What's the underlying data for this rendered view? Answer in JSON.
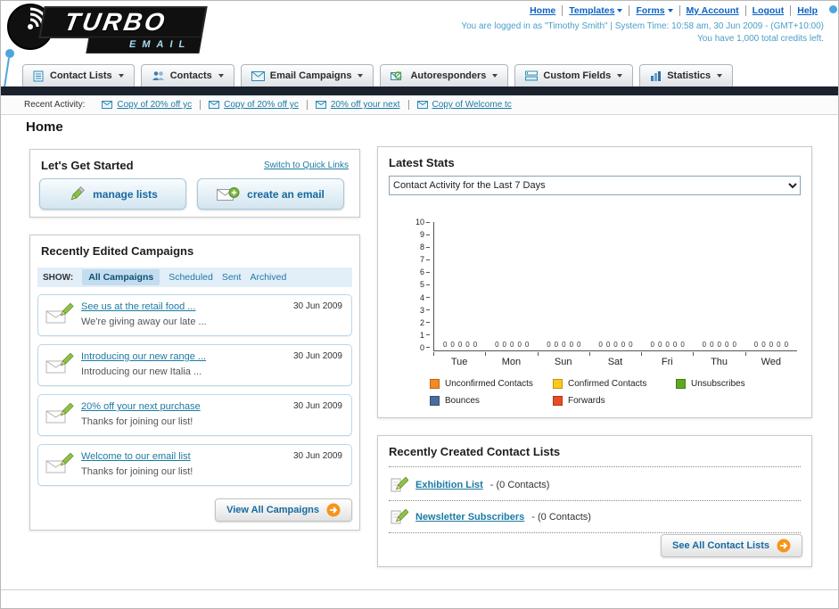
{
  "colors": {
    "accent_teal": "#1b7aa3",
    "navy_bar": "#1b222d",
    "orange": "#f7941d"
  },
  "header": {
    "logo_line1": "TURBO",
    "logo_line2": "EMAIL",
    "nav_links": [
      {
        "label": "Home",
        "dropdown": false
      },
      {
        "label": "Templates",
        "dropdown": true
      },
      {
        "label": "Forms",
        "dropdown": true
      },
      {
        "label": "My Account",
        "dropdown": false
      },
      {
        "label": "Logout",
        "dropdown": false
      },
      {
        "label": "Help",
        "dropdown": false
      }
    ],
    "login_info": "You are logged in as \"Timothy Smith\" | System Time: 10:58 am, 30 Jun 2009 - (GMT+10:00)",
    "credits_info": "You have 1,000 total credits left."
  },
  "main_nav": {
    "items": [
      {
        "label": "Contact Lists"
      },
      {
        "label": "Contacts"
      },
      {
        "label": "Email Campaigns"
      },
      {
        "label": "Autoresponders"
      },
      {
        "label": "Custom Fields"
      },
      {
        "label": "Statistics"
      }
    ]
  },
  "recent_activity": {
    "label": "Recent Activity:",
    "items": [
      {
        "label": "Copy of 20% off yc"
      },
      {
        "label": "Copy of 20% off yc"
      },
      {
        "label": "20% off your next"
      },
      {
        "label": "Copy of Welcome tc"
      }
    ]
  },
  "page": {
    "title": "Home"
  },
  "get_started": {
    "title": "Let's Get Started",
    "switch_link": "Switch to Quick Links",
    "manage_lists_label": "manage lists",
    "create_email_label": "create an email"
  },
  "campaigns": {
    "title": "Recently Edited Campaigns",
    "show_label": "SHOW:",
    "tabs": [
      {
        "label": "All Campaigns",
        "active": true
      },
      {
        "label": "Scheduled",
        "active": false
      },
      {
        "label": "Sent",
        "active": false
      },
      {
        "label": "Archived",
        "active": false
      }
    ],
    "items": [
      {
        "title": "See us at the retail food ...",
        "subtitle": "We're giving away our late ...",
        "date": "30 Jun 2009"
      },
      {
        "title": "Introducing our new range ...",
        "subtitle": "Introducing our new Italia ...",
        "date": "30 Jun 2009"
      },
      {
        "title": "20% off your next purchase",
        "subtitle": "Thanks for joining our list!",
        "date": "30 Jun 2009"
      },
      {
        "title": "Welcome to our email list",
        "subtitle": "Thanks for joining our list!",
        "date": "30 Jun 2009"
      }
    ],
    "view_all_label": "View All Campaigns"
  },
  "latest_stats": {
    "title": "Latest Stats",
    "selected_option": "Contact Activity for the Last 7 Days",
    "chart_data": {
      "type": "bar",
      "title": "Contact Activity for the Last 7 Days",
      "categories": [
        "Tue",
        "Mon",
        "Sun",
        "Sat",
        "Fri",
        "Thu",
        "Wed"
      ],
      "series": [
        {
          "name": "Unconfirmed Contacts",
          "color": "#f6891f",
          "values": [
            0,
            0,
            0,
            0,
            0,
            0,
            0
          ]
        },
        {
          "name": "Confirmed Contacts",
          "color": "#fdc918",
          "values": [
            0,
            0,
            0,
            0,
            0,
            0,
            0
          ]
        },
        {
          "name": "Unsubscribes",
          "color": "#5da81f",
          "values": [
            0,
            0,
            0,
            0,
            0,
            0,
            0
          ]
        },
        {
          "name": "Bounces",
          "color": "#4b6c9e",
          "values": [
            0,
            0,
            0,
            0,
            0,
            0,
            0
          ]
        },
        {
          "name": "Forwards",
          "color": "#e84c22",
          "values": [
            0,
            0,
            0,
            0,
            0,
            0,
            0
          ]
        }
      ],
      "ylim": [
        0,
        10
      ],
      "ytick_step": 1,
      "grid": false,
      "legend_position": "bottom"
    }
  },
  "contact_lists": {
    "title": "Recently Created Contact Lists",
    "items": [
      {
        "name": "Exhibition List",
        "suffix": "- (0 Contacts)"
      },
      {
        "name": "Newsletter Subscribers",
        "suffix": "- (0 Contacts)"
      }
    ],
    "see_all_label": "See All Contact Lists"
  }
}
